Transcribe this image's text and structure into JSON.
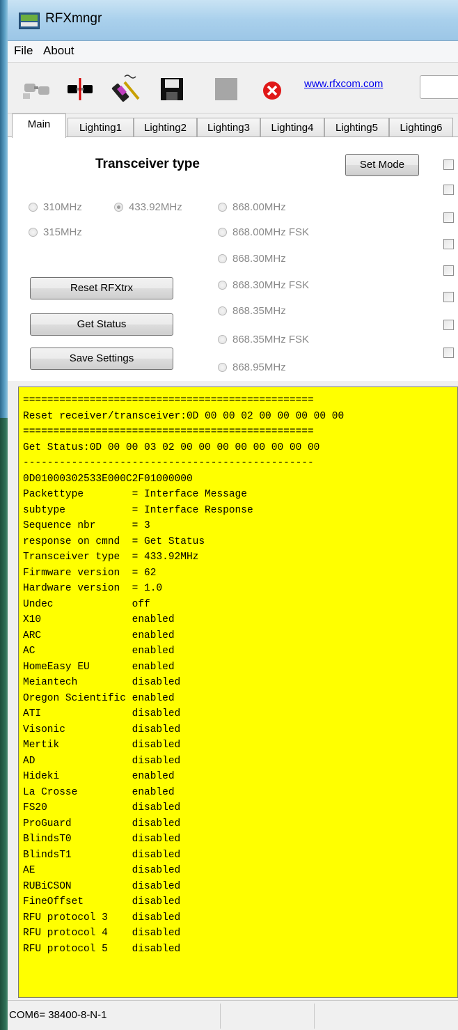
{
  "window": {
    "title": "RFXmngr"
  },
  "menu": [
    "File",
    "About"
  ],
  "toolbar": {
    "icons": [
      "disconnect-icon",
      "connect-icon",
      "transmit-icon",
      "save-icon",
      "stop-icon",
      "close-icon"
    ],
    "link": "www.rfxcom.com"
  },
  "tabs": [
    "Main",
    "Lighting1",
    "Lighting2",
    "Lighting3",
    "Lighting4",
    "Lighting5",
    "Lighting6"
  ],
  "main": {
    "heading": "Transceiver type",
    "set_mode": "Set Mode",
    "freq_left": [
      "310MHz",
      "315MHz"
    ],
    "freq_mid": "433.92MHz",
    "freq_right": [
      "868.00MHz",
      "868.00MHz FSK",
      "868.30MHz",
      "868.30MHz FSK",
      "868.35MHz",
      "868.35MHz FSK",
      "868.95MHz"
    ],
    "selected": "433.92MHz",
    "buttons": [
      "Reset RFXtrx",
      "Get Status",
      "Save Settings"
    ]
  },
  "log": {
    "background": "#ffff00",
    "lines": [
      "================================================",
      "Reset receiver/transceiver:0D 00 00 02 00 00 00 00 00",
      "================================================",
      "Get Status:0D 00 00 03 02 00 00 00 00 00 00 00 00",
      "------------------------------------------------",
      "0D01000302533E000C2F01000000",
      "Packettype        = Interface Message",
      "subtype           = Interface Response",
      "Sequence nbr      = 3",
      "response on cmnd  = Get Status",
      "Transceiver type  = 433.92MHz",
      "Firmware version  = 62",
      "Hardware version  = 1.0",
      "Undec             off",
      "X10               enabled",
      "ARC               enabled",
      "AC                enabled",
      "HomeEasy EU       enabled",
      "Meiantech         disabled",
      "Oregon Scientific enabled",
      "ATI               disabled",
      "Visonic           disabled",
      "Mertik            disabled",
      "AD                disabled",
      "Hideki            enabled",
      "La Crosse         enabled",
      "FS20              disabled",
      "ProGuard          disabled",
      "BlindsT0          disabled",
      "BlindsT1          disabled",
      "AE                disabled",
      "RUBiCSON          disabled",
      "FineOffset        disabled",
      "RFU protocol 3    disabled",
      "RFU protocol 4    disabled",
      "RFU protocol 5    disabled"
    ]
  },
  "status": {
    "port": "COM6= 38400-8-N-1"
  }
}
